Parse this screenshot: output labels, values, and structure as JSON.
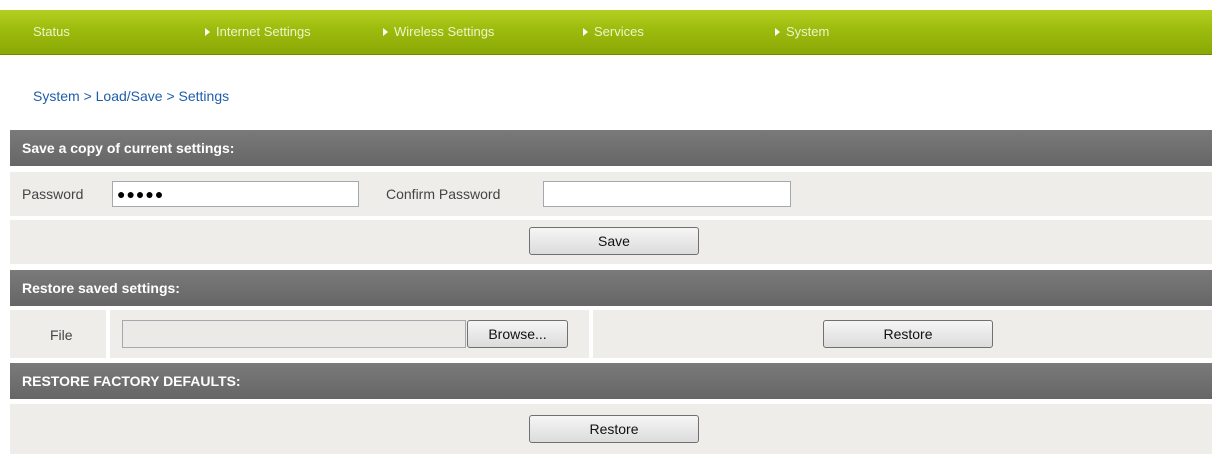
{
  "nav": {
    "items": [
      {
        "label": "Status",
        "arrow": false
      },
      {
        "label": "Internet Settings",
        "arrow": true
      },
      {
        "label": "Wireless Settings",
        "arrow": true
      },
      {
        "label": "Services",
        "arrow": true
      },
      {
        "label": "System",
        "arrow": true
      }
    ]
  },
  "breadcrumb": "System > Load/Save > Settings",
  "save_section": {
    "header": "Save a copy of current settings:",
    "password_label": "Password",
    "password_value": "●●●●●",
    "confirm_label": "Confirm Password",
    "confirm_value": "",
    "save_button": "Save"
  },
  "restore_section": {
    "header": "Restore saved settings:",
    "file_label": "File",
    "browse_button": "Browse...",
    "restore_button": "Restore"
  },
  "factory_section": {
    "header": "RESTORE FACTORY DEFAULTS:",
    "restore_button": "Restore"
  },
  "colors": {
    "nav_green": "#9cbb0d",
    "header_gray": "#707070",
    "row_bg": "#efedea",
    "breadcrumb_blue": "#1f5ea8"
  }
}
